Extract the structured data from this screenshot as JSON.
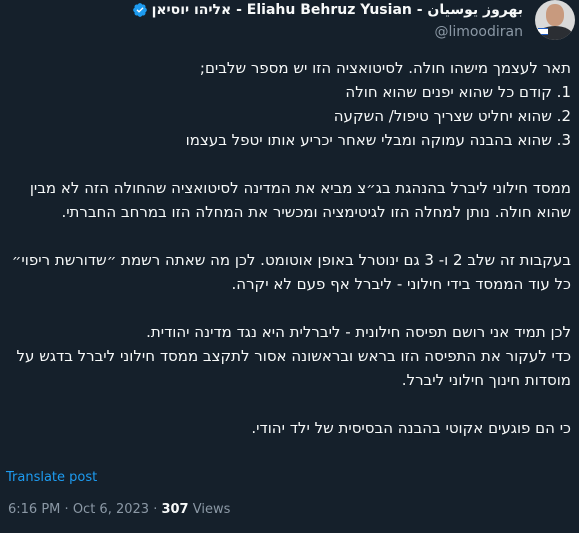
{
  "author": {
    "display_name": "אליהו יוסיאן - Eliahu Behruz Yusian - بهروز یوسیان",
    "handle": "@limoodiran",
    "verified": true
  },
  "tweet": {
    "paragraphs": [
      "תאר לעצמך מישהו חולה. לסיטואציה הזו יש מספר שלבים;\n1. קודם כל שהוא יפנים שהוא חולה\n2. שהוא יחליט שצריך טיפול/ השקעה\n3. שהוא בהבנה עמוקה ומבלי שאחר יכריע אותו יטפל בעצמו",
      "ממסד חילוני ליברל בהנהגת בג״צ מביא את המדינה לסיטואציה שהחולה הזה לא מבין שהוא חולה. נותן למחלה הזו לגיטימציה ומכשיר את המחלה הזו במרחב החברתי.",
      "בעקבות זה שלב 2 ו- 3 גם ינוטרל באופן אוטומט. לכן מה שאתה רשמת ״שדורשת ריפוי״ כל עוד הממסד בידי חילוני - ליברל אף פעם לא יקרה.",
      "לכן תמיד אני רושם תפיסה חילונית - ליברלית היא נגד מדינה יהודית.\nכדי לעקור את התפיסה הזו בראש ובראשונה אסור לתקצב ממסד חילוני ליברל בדגש על מוסדות חינוך חילוני ליברל.",
      "כי הם פוגעים אקוטי בהבנה הבסיסית של ילד יהודי."
    ],
    "translate_label": "Translate post",
    "time": "6:16 PM",
    "separator": "·",
    "date": "Oct 6, 2023",
    "views_count": "307",
    "views_label": "Views"
  },
  "colors": {
    "background": "#15202b",
    "text": "#f7f9f9",
    "secondary": "#8b98a5",
    "accent": "#1d9bf0"
  },
  "icons": {
    "verified": "verified-badge-icon",
    "more": "more-options-icon"
  }
}
